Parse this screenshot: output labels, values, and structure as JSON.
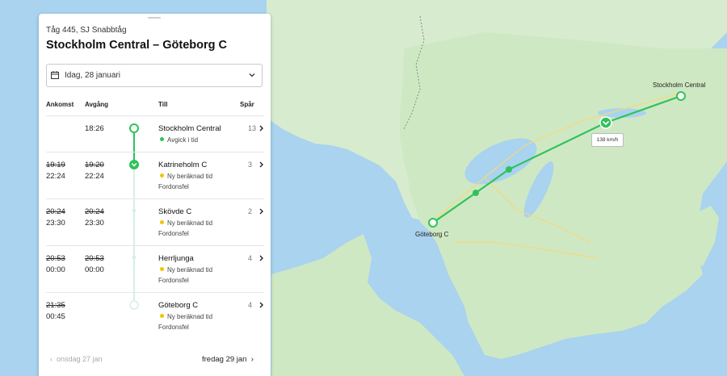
{
  "train": {
    "subtitle": "Tåg 445, SJ Snabbtåg",
    "title": "Stockholm Central – Göteborg C"
  },
  "date_select": {
    "label": "Idag, 28 januari",
    "icon": "calendar-icon"
  },
  "columns": {
    "arrival": "Ankomst",
    "departure": "Avgång",
    "to": "Till",
    "track": "Spår"
  },
  "stops": [
    {
      "arr_old": "",
      "arr": "",
      "dep_old": "",
      "dep": "18:26",
      "station": "Stockholm Central",
      "status": "Avgick i tid",
      "status_color": "#2fc25b",
      "note": "",
      "track": "13"
    },
    {
      "arr_old": "19:19",
      "arr": "22:24",
      "dep_old": "19:20",
      "dep": "22:24",
      "station": "Katrineholm C",
      "status": "Ny beräknad tid",
      "status_color": "#f3c400",
      "note": "Fordonsfel",
      "track": "3"
    },
    {
      "arr_old": "20:24",
      "arr": "23:30",
      "dep_old": "20:24",
      "dep": "23:30",
      "station": "Skövde C",
      "status": "Ny beräknad tid",
      "status_color": "#f3c400",
      "note": "Fordonsfel",
      "track": "2"
    },
    {
      "arr_old": "20:53",
      "arr": "00:00",
      "dep_old": "20:53",
      "dep": "00:00",
      "station": "Herrljunga",
      "status": "Ny beräknad tid",
      "status_color": "#f3c400",
      "note": "Fordonsfel",
      "track": "4"
    },
    {
      "arr_old": "21:35",
      "arr": "00:45",
      "dep_old": "",
      "dep": "",
      "station": "Göteborg C",
      "status": "Ny beräknad tid",
      "status_color": "#f3c400",
      "note": "Fordonsfel",
      "track": "4"
    }
  ],
  "footer": {
    "prev": "onsdag 27 jan",
    "next": "fredag 29 jan"
  },
  "map": {
    "origin_label": "Stockholm Central",
    "dest_label": "Göteborg C",
    "speed": "138 km/h",
    "route_color": "#2fc25b",
    "water_color": "#a9d3ef",
    "land_color": "#cfe8c4"
  }
}
